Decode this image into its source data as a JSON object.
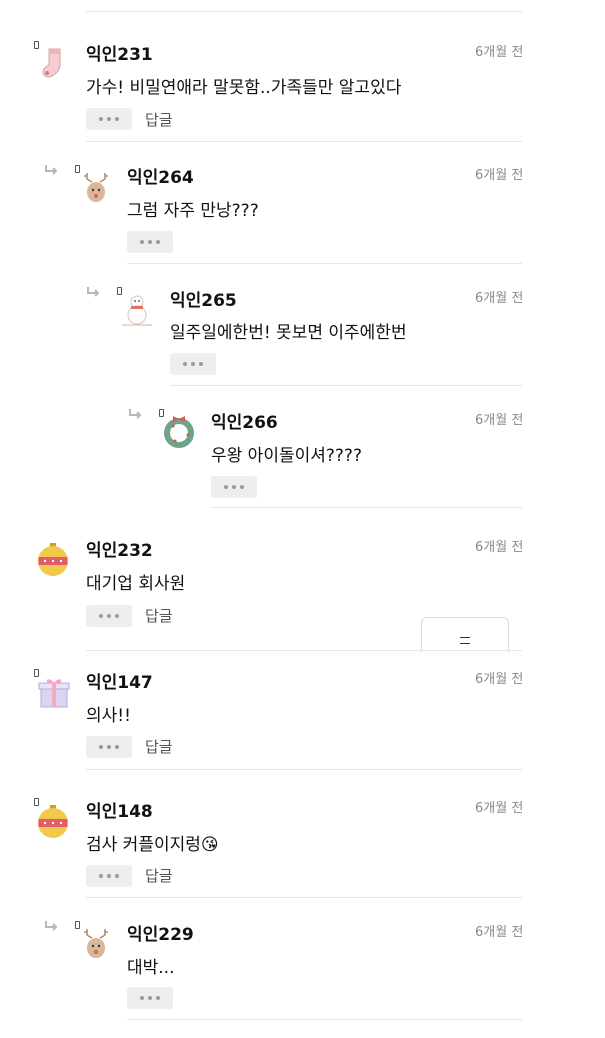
{
  "comments": [
    {
      "name": "익인231",
      "time": "6개월 전",
      "text": "가수! 비밀연애라 말못함..가족들만 알고있다",
      "reply_label": "답글",
      "avatar": "sock-icon"
    },
    {
      "name": "익인264",
      "time": "6개월 전",
      "text": "그럼 자주 만낭???",
      "avatar": "reindeer-icon"
    },
    {
      "name": "익인265",
      "time": "6개월 전",
      "text": "일주일에한번! 못보면 이주에한번",
      "avatar": "snowman-icon"
    },
    {
      "name": "익인266",
      "time": "6개월 전",
      "text": "우왕 아이돌이셔????",
      "avatar": "wreath-icon"
    },
    {
      "name": "익인232",
      "time": "6개월 전",
      "text": "대기업 회사원",
      "reply_label": "답글",
      "avatar": "ornament-icon"
    },
    {
      "name": "익인147",
      "time": "6개월 전",
      "text": "의사!!",
      "reply_label": "답글",
      "avatar": "gift-box-icon"
    },
    {
      "name": "익인148",
      "time": "6개월 전",
      "text": "검사 커플이지렁",
      "emoji": "😘",
      "reply_label": "답글",
      "avatar": "ornament-icon"
    },
    {
      "name": "익인229",
      "time": "6개월 전",
      "text": "대박...",
      "avatar": "reindeer-icon"
    }
  ]
}
